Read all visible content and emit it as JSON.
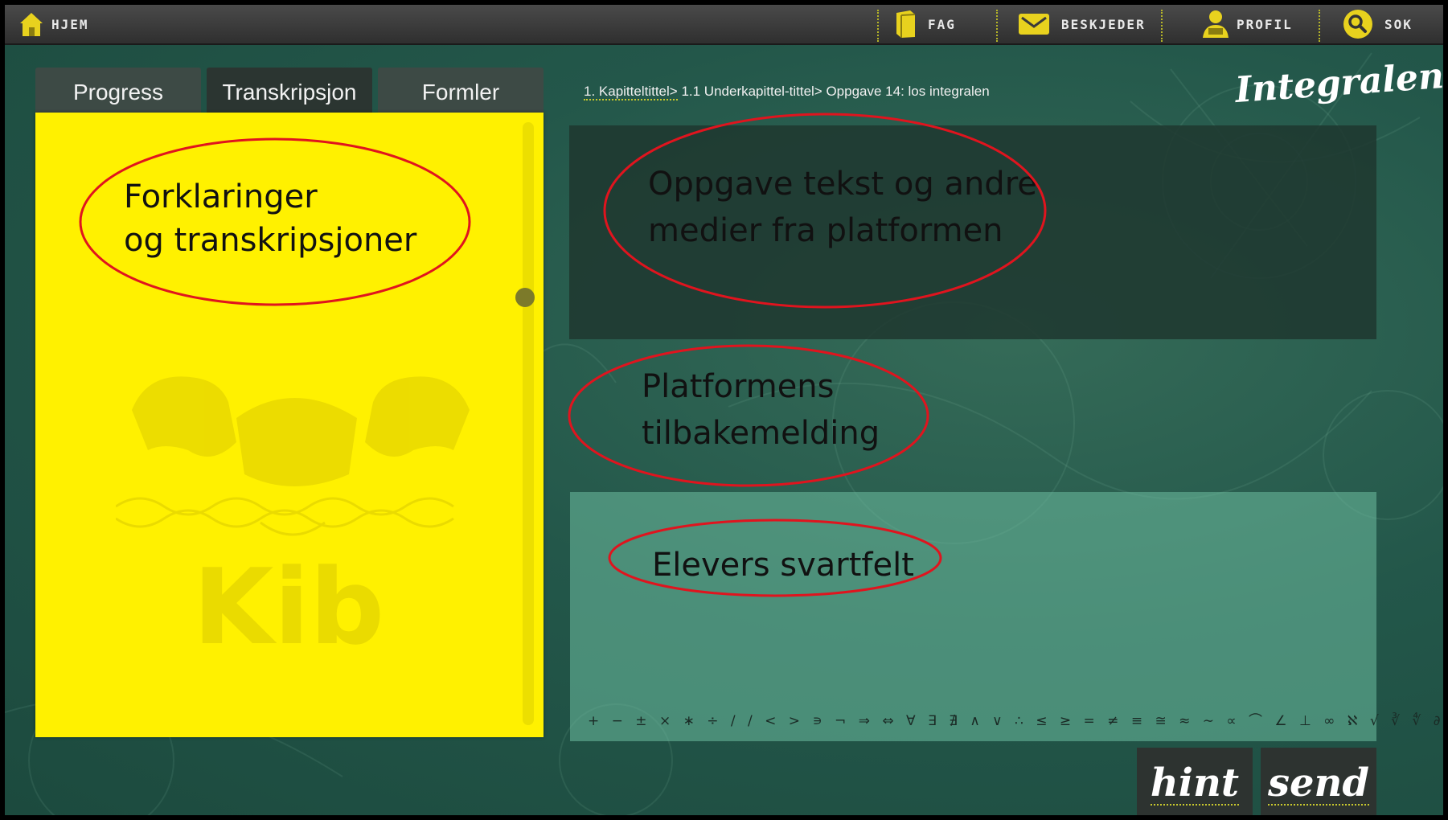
{
  "nav": {
    "home_label": "HJEM",
    "subjects_label": "FAG",
    "messages_label": "BESKJEDER",
    "profile_label": "PROFIL",
    "search_label": "SOK",
    "icons": [
      "home-icon",
      "book-icon",
      "envelope-icon",
      "profile-icon",
      "search-icon"
    ],
    "accent": "#e8d21e"
  },
  "tabs": [
    {
      "label": "Progress",
      "active": false
    },
    {
      "label": "Transkripsjon",
      "active": true
    },
    {
      "label": "Formler",
      "active": false
    }
  ],
  "left_panel": {
    "background": "#fff100",
    "annotation_line1": "Forklaringer",
    "annotation_line2": "og transkripsjoner",
    "watermark_text": "Kib"
  },
  "breadcrumb": {
    "first": "1. Kapitteltittel>",
    "rest": " 1.1 Underkapittel-tittel> Oppgave 14: los integralen"
  },
  "brand": "Integralen",
  "annotations": {
    "task_line1": "Oppgave tekst og andre",
    "task_line2": "medier fra platformen",
    "feedback_line1": "Platformens",
    "feedback_line2": "tilbakemelding",
    "answer": "Elevers svartfelt",
    "ellipse_color": "#e0141e"
  },
  "symbols": "+ − ± × ∗ ÷ / / < > ∍ ¬ ⇒ ⇔ ∀ ∃ ∄ ∧ ∨ ∴ ≤ ≥ = ≠ ≡ ≅ ≈ ∼ ∝ ⌒ ∠ ⊥ ∞ ℵ √ ∛ ∜ ∂ ∇ ∆",
  "buttons": {
    "hint": "hint",
    "send": "send"
  }
}
